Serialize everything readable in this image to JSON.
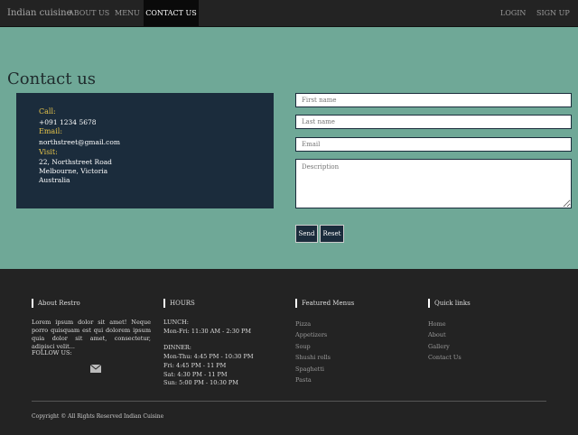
{
  "nav": {
    "brand": "Indian cuisine",
    "about": "ABOUT US",
    "menu": "MENU",
    "contact": "CONTACT US",
    "login": "LOGIN",
    "signup": "SIGN UP"
  },
  "page_title": "Contact us",
  "contact_info": {
    "call_label": "Call:",
    "phone": "+091 1234 5678",
    "email_label": "Email:",
    "email": "northstreet@gmail.com",
    "visit_label": "Visit:",
    "address_line1": "22, Northstreet Road",
    "address_line2": "Melbourne, Victoria",
    "address_line3": "Australia"
  },
  "form": {
    "first_name_placeholder": "First name",
    "last_name_placeholder": "Last name",
    "email_placeholder": "Email",
    "description_placeholder": "Description",
    "send_label": "Send",
    "reset_label": "Reset"
  },
  "footer": {
    "about_title": "About Restro",
    "about_text": "Lorem ipsum dolor sit amet! Neque porro quisquam est qui dolorem ipsum quia dolor sit amet, consectetur, adipisci velit...",
    "follow_us": "FOLLOW US:",
    "hours_title": "HOURS",
    "lunch_label": "LUNCH:",
    "lunch_hours": "Mon-Fri: 11:30 AM - 2:30 PM",
    "dinner_label": "DINNER:",
    "dinner_1": "Mon-Thu: 4:45 PM - 10:30 PM",
    "dinner_2": "Fri: 4:45 PM - 11 PM",
    "dinner_3": "Sat: 4:30 PM - 11 PM",
    "dinner_4": "Sun: 5:00 PM - 10:30 PM",
    "menus_title": "Featured Menus",
    "menus": [
      "Pizza",
      "Appetizers",
      "Soup",
      "Shushi rolls",
      "Spaghetti",
      "Pasta"
    ],
    "links_title": "Quick links",
    "links": [
      "Home",
      "About",
      "Gallery",
      "Contact Us"
    ],
    "copyright": "Copyright © All Rights Reserved Indian Cuisine"
  },
  "icons": {
    "mail": "envelope-icon"
  }
}
